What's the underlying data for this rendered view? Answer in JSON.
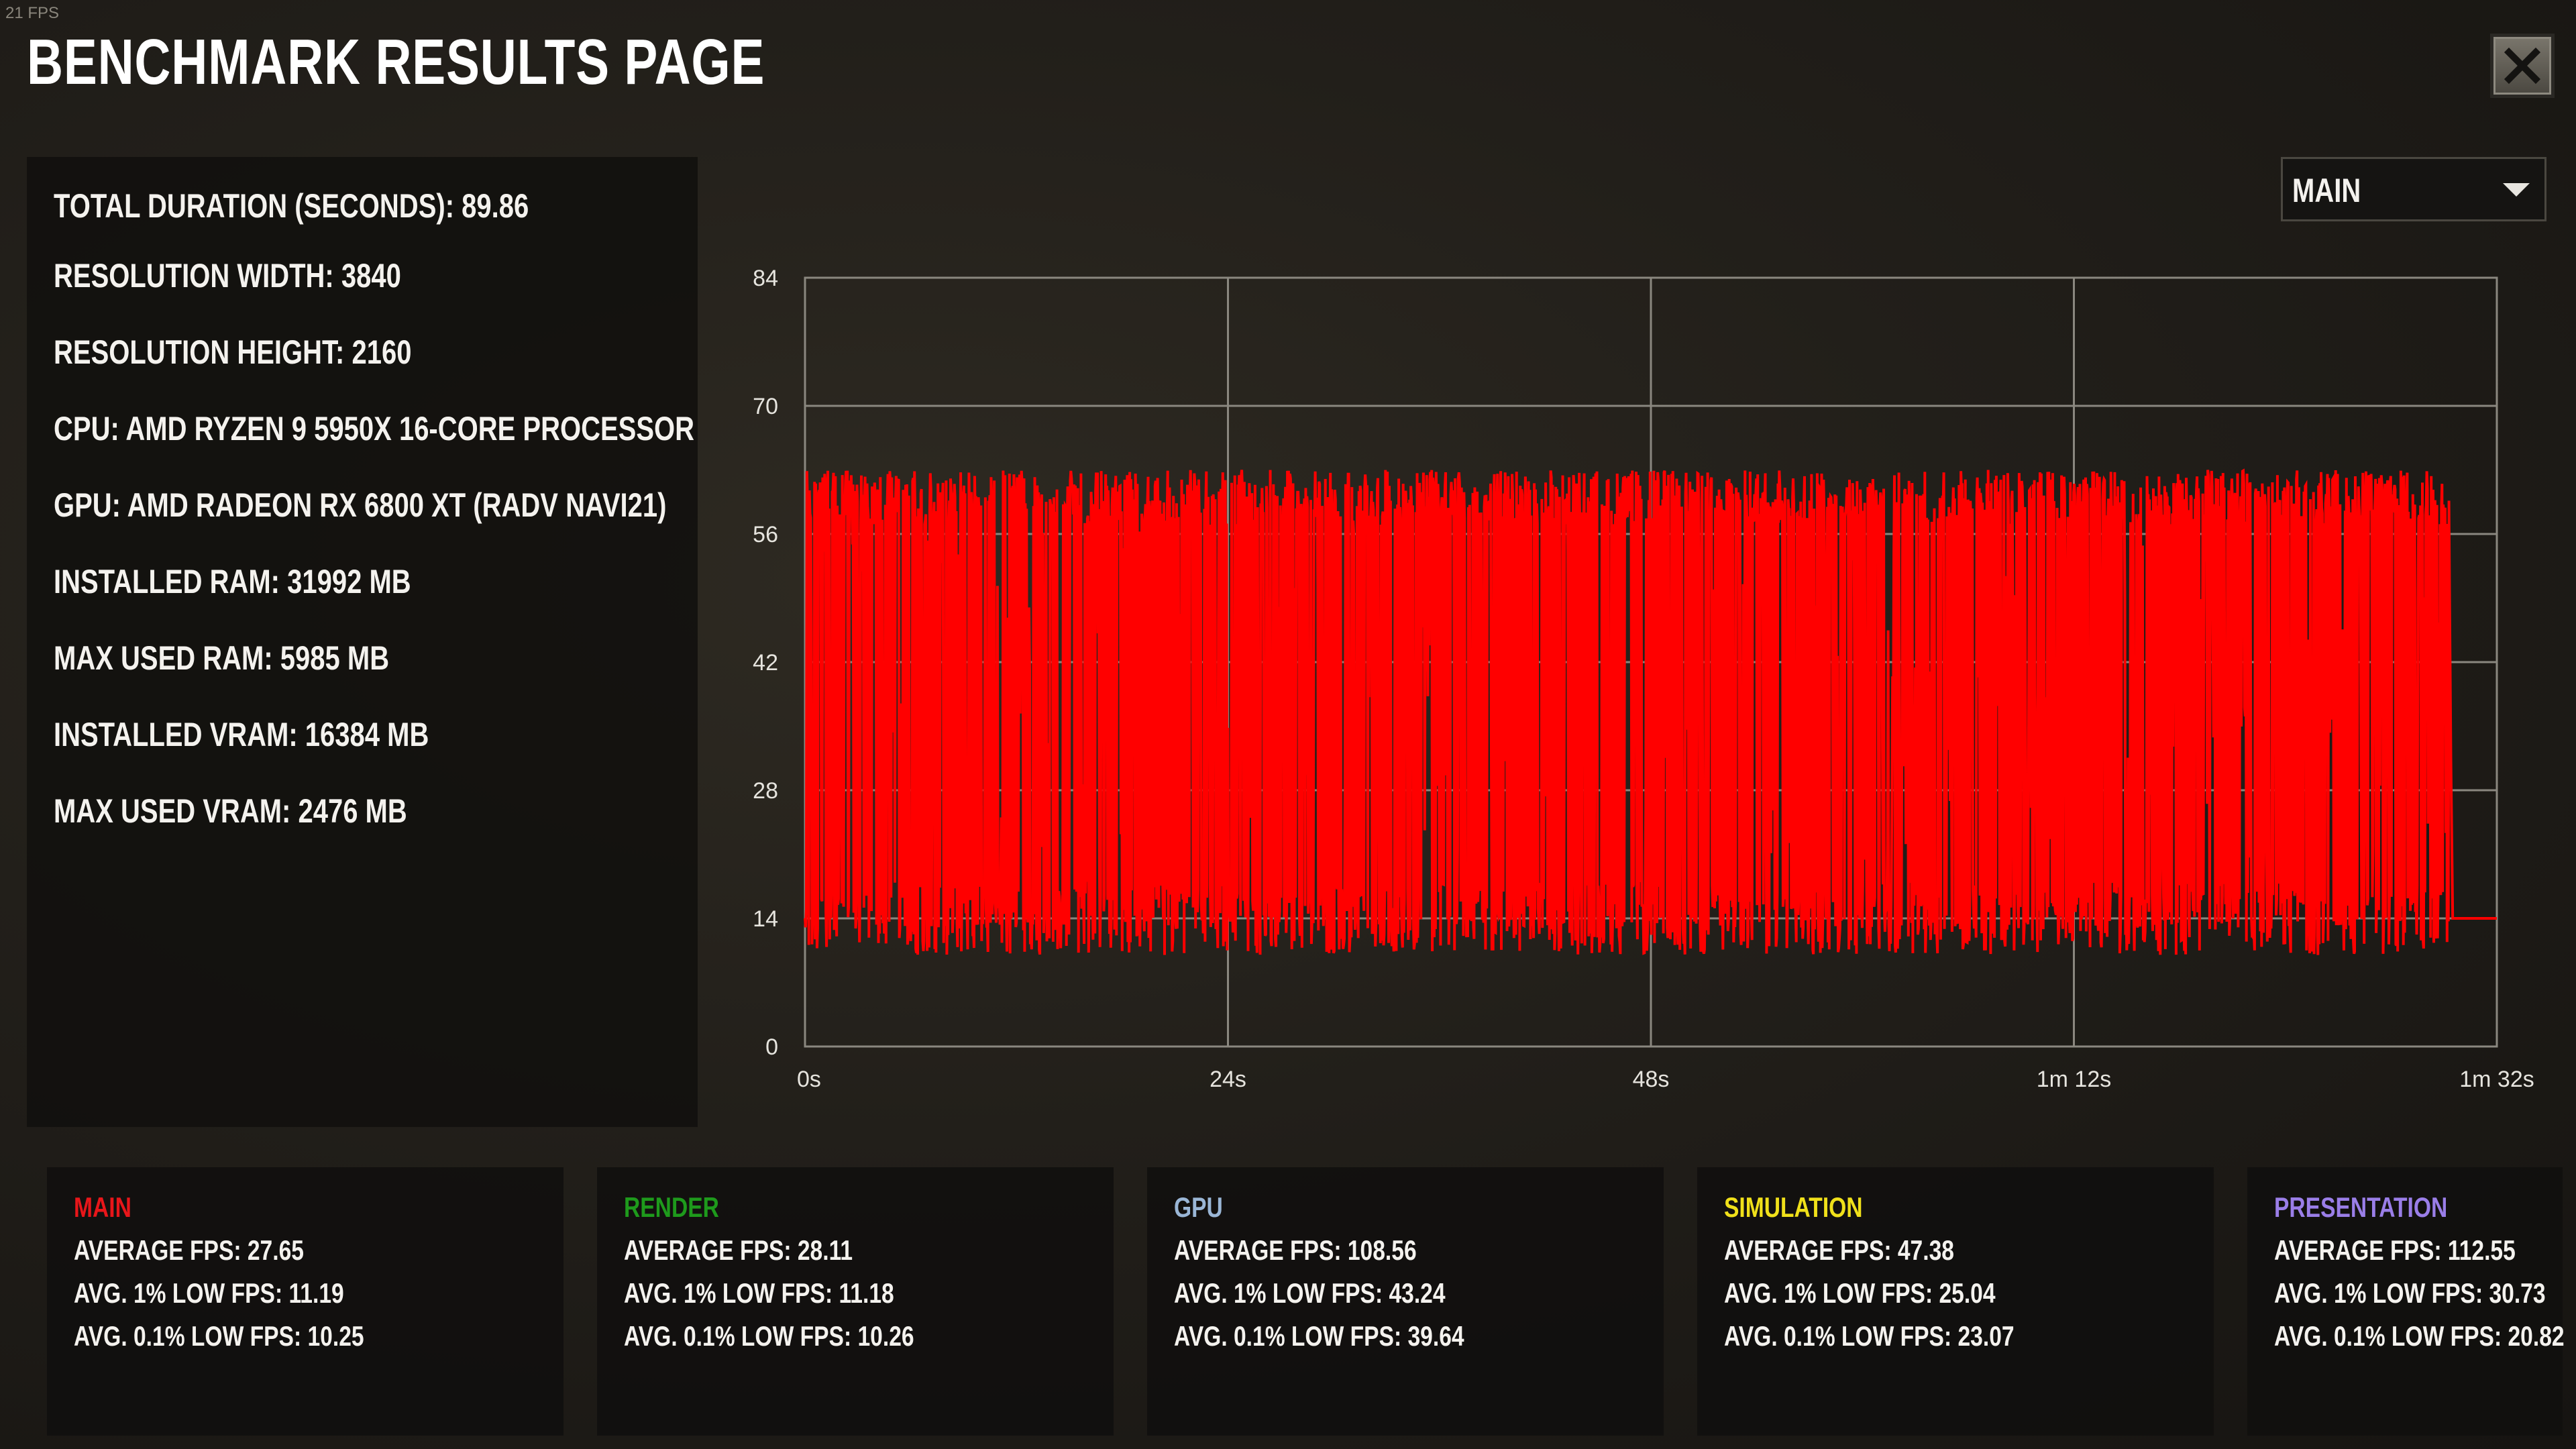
{
  "fps_counter": "21 FPS",
  "title": "BENCHMARK RESULTS PAGE",
  "close_button": {
    "icon": "close-icon"
  },
  "system_info": [
    "TOTAL DURATION (SECONDS): 89.86",
    "RESOLUTION WIDTH: 3840",
    "RESOLUTION HEIGHT: 2160",
    "CPU: AMD RYZEN 9 5950X 16-CORE PROCESSOR",
    "GPU: AMD RADEON RX 6800 XT (RADV NAVI21)",
    "INSTALLED RAM: 31992 MB",
    "MAX USED RAM: 5985 MB",
    "INSTALLED VRAM: 16384 MB",
    "MAX USED VRAM: 2476 MB"
  ],
  "dropdown": {
    "selected": "MAIN",
    "icon": "caret-down-icon"
  },
  "chart_data": {
    "type": "line",
    "series": [
      {
        "color": "#ff0000",
        "duration_seconds": 92,
        "min": 10,
        "max": 63,
        "plateau": 14
      }
    ],
    "ylim": [
      0,
      84
    ],
    "yticks": [
      "0",
      "14",
      "28",
      "42",
      "56",
      "70",
      "84"
    ],
    "xlim": [
      0,
      92
    ],
    "xticks": [
      "0s",
      "24s",
      "48s",
      "1m 12s",
      "1m 32s"
    ],
    "grid": true,
    "colors": {
      "line": "#ff0000",
      "grid": "#8a877f"
    }
  },
  "stats": [
    {
      "name": "MAIN",
      "color": "#e8161a",
      "lines": [
        "AVERAGE FPS: 27.65",
        "AVG. 1% LOW FPS: 11.19",
        "AVG. 0.1% LOW FPS: 10.25"
      ]
    },
    {
      "name": "RENDER",
      "color": "#1e9a1c",
      "lines": [
        "AVERAGE FPS: 28.11",
        "AVG. 1% LOW FPS: 11.18",
        "AVG. 0.1% LOW FPS: 10.26"
      ]
    },
    {
      "name": "GPU",
      "color": "#9ab6d6",
      "lines": [
        "AVERAGE FPS: 108.56",
        "AVG. 1% LOW FPS: 43.24",
        "AVG. 0.1% LOW FPS: 39.64"
      ]
    },
    {
      "name": "SIMULATION",
      "color": "#f0e01a",
      "lines": [
        "AVERAGE FPS: 47.38",
        "AVG. 1% LOW FPS: 25.04",
        "AVG. 0.1% LOW FPS: 23.07"
      ]
    },
    {
      "name": "PRESENTATION",
      "color": "#9a7ee8",
      "lines": [
        "AVERAGE FPS: 112.55",
        "AVG. 1% LOW FPS: 30.73",
        "AVG. 0.1% LOW FPS: 20.82"
      ]
    }
  ]
}
